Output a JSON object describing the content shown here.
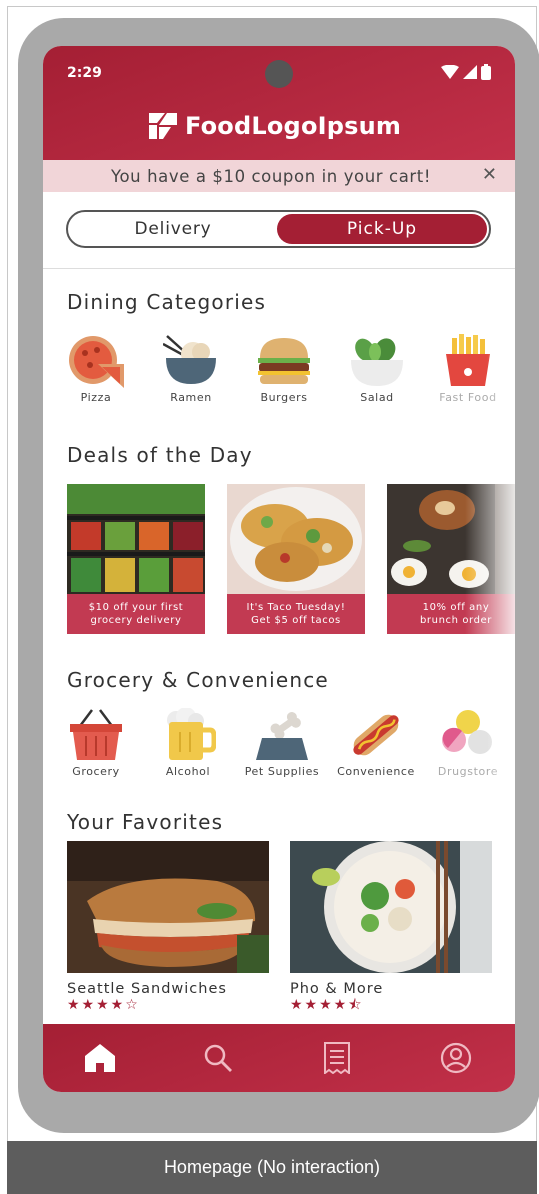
{
  "status_bar": {
    "time": "2:29"
  },
  "brand": {
    "name": "FoodLogoIpsum"
  },
  "coupon": {
    "text": "You have a $10 coupon in your cart!",
    "close_symbol": "✕"
  },
  "mode_toggle": {
    "delivery_label": "Delivery",
    "pickup_label": "Pick-Up",
    "selected": "Pick-Up"
  },
  "dining": {
    "title": "Dining Categories",
    "items": [
      {
        "label": "Pizza",
        "icon": "pizza-icon"
      },
      {
        "label": "Ramen",
        "icon": "ramen-icon"
      },
      {
        "label": "Burgers",
        "icon": "burger-icon"
      },
      {
        "label": "Salad",
        "icon": "salad-icon"
      },
      {
        "label": "Fast Food",
        "icon": "fries-icon"
      }
    ]
  },
  "deals": {
    "title": "Deals of the Day",
    "items": [
      {
        "line1": "$10 off your first",
        "line2": "grocery delivery"
      },
      {
        "line1": "It's Taco Tuesday!",
        "line2": "Get $5 off tacos"
      },
      {
        "line1": "10% off any",
        "line2": "brunch order"
      }
    ]
  },
  "grocery": {
    "title": "Grocery & Convenience",
    "items": [
      {
        "label": "Grocery",
        "icon": "basket-icon"
      },
      {
        "label": "Alcohol",
        "icon": "beer-icon"
      },
      {
        "label": "Pet Supplies",
        "icon": "pet-bowl-icon"
      },
      {
        "label": "Convenience",
        "icon": "hotdog-icon"
      },
      {
        "label": "Drugstore",
        "icon": "pill-icon"
      }
    ]
  },
  "favorites": {
    "title": "Your Favorites",
    "items": [
      {
        "name": "Seattle Sandwiches",
        "stars": "★★★★☆",
        "rating": 4
      },
      {
        "name": "Pho & More",
        "stars": "★★★★⯪",
        "rating": 4.5
      }
    ]
  },
  "bottom_nav": [
    {
      "name": "home",
      "icon": "home-icon",
      "active": true
    },
    {
      "name": "search",
      "icon": "search-icon",
      "active": false
    },
    {
      "name": "orders",
      "icon": "receipt-icon",
      "active": false
    },
    {
      "name": "account",
      "icon": "account-icon",
      "active": false
    }
  ],
  "caption": "Homepage (No interaction)",
  "colors": {
    "brand": "#a41f34",
    "brand_light": "#c23049",
    "coupon_bg": "#f1d5d8"
  }
}
